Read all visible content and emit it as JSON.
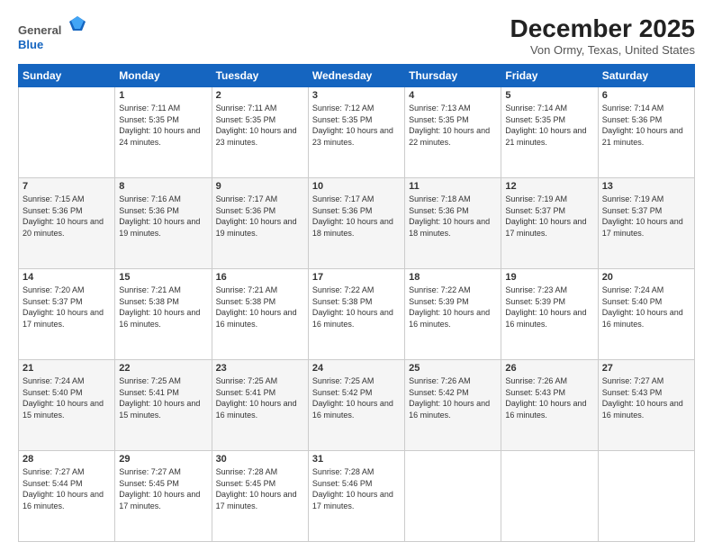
{
  "header": {
    "logo_line1": "General",
    "logo_line2": "Blue",
    "month_title": "December 2025",
    "location": "Von Ormy, Texas, United States"
  },
  "weekdays": [
    "Sunday",
    "Monday",
    "Tuesday",
    "Wednesday",
    "Thursday",
    "Friday",
    "Saturday"
  ],
  "weeks": [
    [
      {
        "day": "",
        "info": ""
      },
      {
        "day": "1",
        "info": "Sunrise: 7:11 AM\nSunset: 5:35 PM\nDaylight: 10 hours and 24 minutes."
      },
      {
        "day": "2",
        "info": "Sunrise: 7:11 AM\nSunset: 5:35 PM\nDaylight: 10 hours and 23 minutes."
      },
      {
        "day": "3",
        "info": "Sunrise: 7:12 AM\nSunset: 5:35 PM\nDaylight: 10 hours and 23 minutes."
      },
      {
        "day": "4",
        "info": "Sunrise: 7:13 AM\nSunset: 5:35 PM\nDaylight: 10 hours and 22 minutes."
      },
      {
        "day": "5",
        "info": "Sunrise: 7:14 AM\nSunset: 5:35 PM\nDaylight: 10 hours and 21 minutes."
      },
      {
        "day": "6",
        "info": "Sunrise: 7:14 AM\nSunset: 5:36 PM\nDaylight: 10 hours and 21 minutes."
      }
    ],
    [
      {
        "day": "7",
        "info": "Sunrise: 7:15 AM\nSunset: 5:36 PM\nDaylight: 10 hours and 20 minutes."
      },
      {
        "day": "8",
        "info": "Sunrise: 7:16 AM\nSunset: 5:36 PM\nDaylight: 10 hours and 19 minutes."
      },
      {
        "day": "9",
        "info": "Sunrise: 7:17 AM\nSunset: 5:36 PM\nDaylight: 10 hours and 19 minutes."
      },
      {
        "day": "10",
        "info": "Sunrise: 7:17 AM\nSunset: 5:36 PM\nDaylight: 10 hours and 18 minutes."
      },
      {
        "day": "11",
        "info": "Sunrise: 7:18 AM\nSunset: 5:36 PM\nDaylight: 10 hours and 18 minutes."
      },
      {
        "day": "12",
        "info": "Sunrise: 7:19 AM\nSunset: 5:37 PM\nDaylight: 10 hours and 17 minutes."
      },
      {
        "day": "13",
        "info": "Sunrise: 7:19 AM\nSunset: 5:37 PM\nDaylight: 10 hours and 17 minutes."
      }
    ],
    [
      {
        "day": "14",
        "info": "Sunrise: 7:20 AM\nSunset: 5:37 PM\nDaylight: 10 hours and 17 minutes."
      },
      {
        "day": "15",
        "info": "Sunrise: 7:21 AM\nSunset: 5:38 PM\nDaylight: 10 hours and 16 minutes."
      },
      {
        "day": "16",
        "info": "Sunrise: 7:21 AM\nSunset: 5:38 PM\nDaylight: 10 hours and 16 minutes."
      },
      {
        "day": "17",
        "info": "Sunrise: 7:22 AM\nSunset: 5:38 PM\nDaylight: 10 hours and 16 minutes."
      },
      {
        "day": "18",
        "info": "Sunrise: 7:22 AM\nSunset: 5:39 PM\nDaylight: 10 hours and 16 minutes."
      },
      {
        "day": "19",
        "info": "Sunrise: 7:23 AM\nSunset: 5:39 PM\nDaylight: 10 hours and 16 minutes."
      },
      {
        "day": "20",
        "info": "Sunrise: 7:24 AM\nSunset: 5:40 PM\nDaylight: 10 hours and 16 minutes."
      }
    ],
    [
      {
        "day": "21",
        "info": "Sunrise: 7:24 AM\nSunset: 5:40 PM\nDaylight: 10 hours and 15 minutes."
      },
      {
        "day": "22",
        "info": "Sunrise: 7:25 AM\nSunset: 5:41 PM\nDaylight: 10 hours and 15 minutes."
      },
      {
        "day": "23",
        "info": "Sunrise: 7:25 AM\nSunset: 5:41 PM\nDaylight: 10 hours and 16 minutes."
      },
      {
        "day": "24",
        "info": "Sunrise: 7:25 AM\nSunset: 5:42 PM\nDaylight: 10 hours and 16 minutes."
      },
      {
        "day": "25",
        "info": "Sunrise: 7:26 AM\nSunset: 5:42 PM\nDaylight: 10 hours and 16 minutes."
      },
      {
        "day": "26",
        "info": "Sunrise: 7:26 AM\nSunset: 5:43 PM\nDaylight: 10 hours and 16 minutes."
      },
      {
        "day": "27",
        "info": "Sunrise: 7:27 AM\nSunset: 5:43 PM\nDaylight: 10 hours and 16 minutes."
      }
    ],
    [
      {
        "day": "28",
        "info": "Sunrise: 7:27 AM\nSunset: 5:44 PM\nDaylight: 10 hours and 16 minutes."
      },
      {
        "day": "29",
        "info": "Sunrise: 7:27 AM\nSunset: 5:45 PM\nDaylight: 10 hours and 17 minutes."
      },
      {
        "day": "30",
        "info": "Sunrise: 7:28 AM\nSunset: 5:45 PM\nDaylight: 10 hours and 17 minutes."
      },
      {
        "day": "31",
        "info": "Sunrise: 7:28 AM\nSunset: 5:46 PM\nDaylight: 10 hours and 17 minutes."
      },
      {
        "day": "",
        "info": ""
      },
      {
        "day": "",
        "info": ""
      },
      {
        "day": "",
        "info": ""
      }
    ]
  ]
}
